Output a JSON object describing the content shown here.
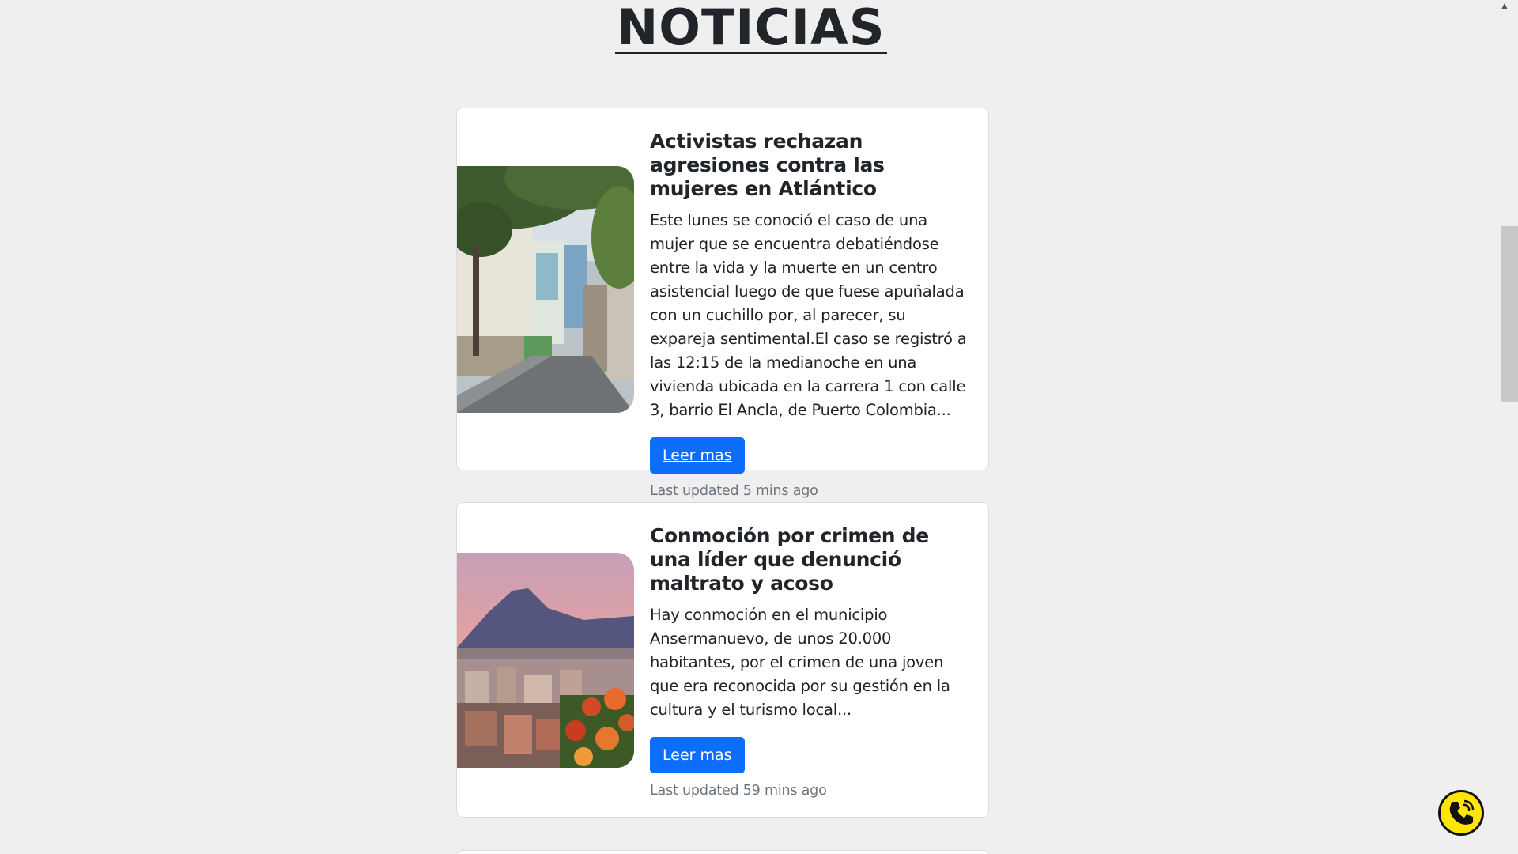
{
  "page": {
    "title": "NOTICIAS"
  },
  "articles": [
    {
      "title": "Activistas rechazan agresiones contra las mujeres en Atlántico",
      "description": "Este lunes se conoció el caso de una mujer que se encuentra debatiéndose entre la vida y la muerte en un centro asistencial luego de que fuese apuñalada con un cuchillo por, al parecer, su expareja sentimental.El caso se registró a las 12:15 de la medianoche en una vivienda ubicada en la carrera 1 con calle 3, barrio El Ancla, de Puerto Colombia...",
      "button_label": "Leer mas",
      "updated": "Last updated 5 mins ago",
      "image_subject": "street-photo"
    },
    {
      "title": "Conmoción por crimen de una líder que denunció maltrato y acoso",
      "description": "Hay conmoción en el municipio Ansermanuevo, de unos 20.000 habitantes, por el crimen de una joven que era reconocida por su gestión en la cultura y el turismo local...",
      "button_label": "Leer mas",
      "updated": "Last updated 59 mins ago",
      "image_subject": "city-mountain-photo"
    }
  ],
  "floating": {
    "icon": "phone-call-icon"
  },
  "colors": {
    "primary": "#0d6efd",
    "call_button": "#ffe600",
    "background": "#efefef"
  }
}
